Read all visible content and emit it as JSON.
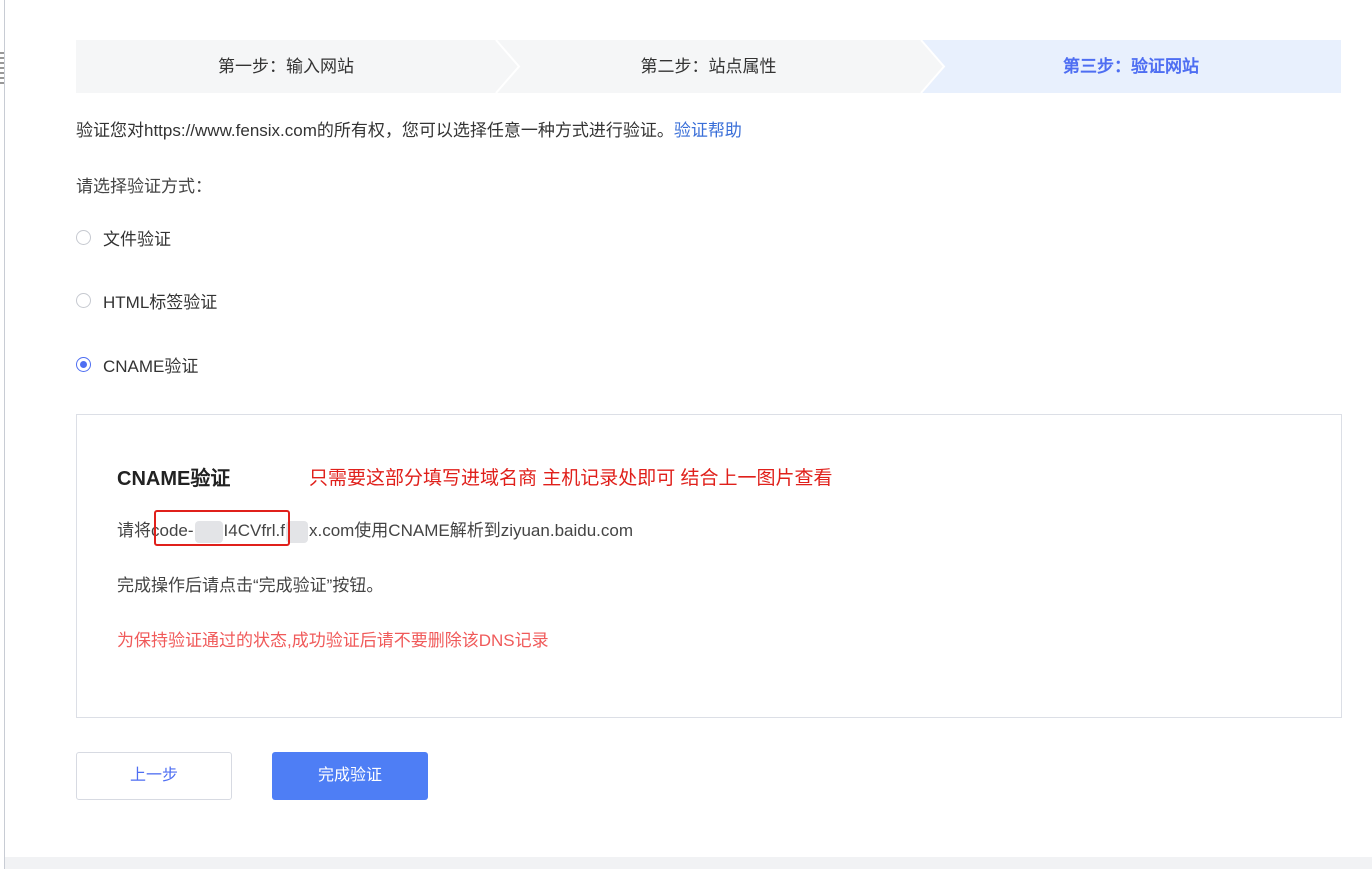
{
  "steps": [
    {
      "label": "第一步：输入网站",
      "active": false
    },
    {
      "label": "第二步：站点属性",
      "active": false
    },
    {
      "label": "第三步：验证网站",
      "active": true
    }
  ],
  "intro": {
    "text": "验证您对https://www.fensix.com的所有权，您可以选择任意一种方式进行验证。",
    "help_link": "验证帮助"
  },
  "method_prompt": "请选择验证方式：",
  "methods": [
    {
      "label": "文件验证",
      "checked": false
    },
    {
      "label": "HTML标签验证",
      "checked": false
    },
    {
      "label": "CNAME验证",
      "checked": true
    }
  ],
  "panel": {
    "title": "CNAME验证",
    "annotation": "只需要这部分填写进域名商 主机记录处即可 结合上一图片查看",
    "instruction": {
      "prefix": "请将",
      "code_start": "code-",
      "code_end": "I4CVfrl",
      "host_part": "f",
      "suffix": "x.com使用CNAME解析到ziyuan.baidu.com"
    },
    "done_tip": "完成操作后请点击“完成验证”按钮。",
    "warning": "为保持验证通过的状态,成功验证后请不要删除该DNS记录"
  },
  "buttons": {
    "prev": "上一步",
    "finish": "完成验证"
  },
  "colors": {
    "accent": "#4e6ef2",
    "primary_button": "#4e7ef5",
    "annotation_red": "#e0201b",
    "warning_red": "#f05a5a",
    "step_active_bg": "#e8f0fd",
    "step_inactive_bg": "#f5f6f7"
  }
}
